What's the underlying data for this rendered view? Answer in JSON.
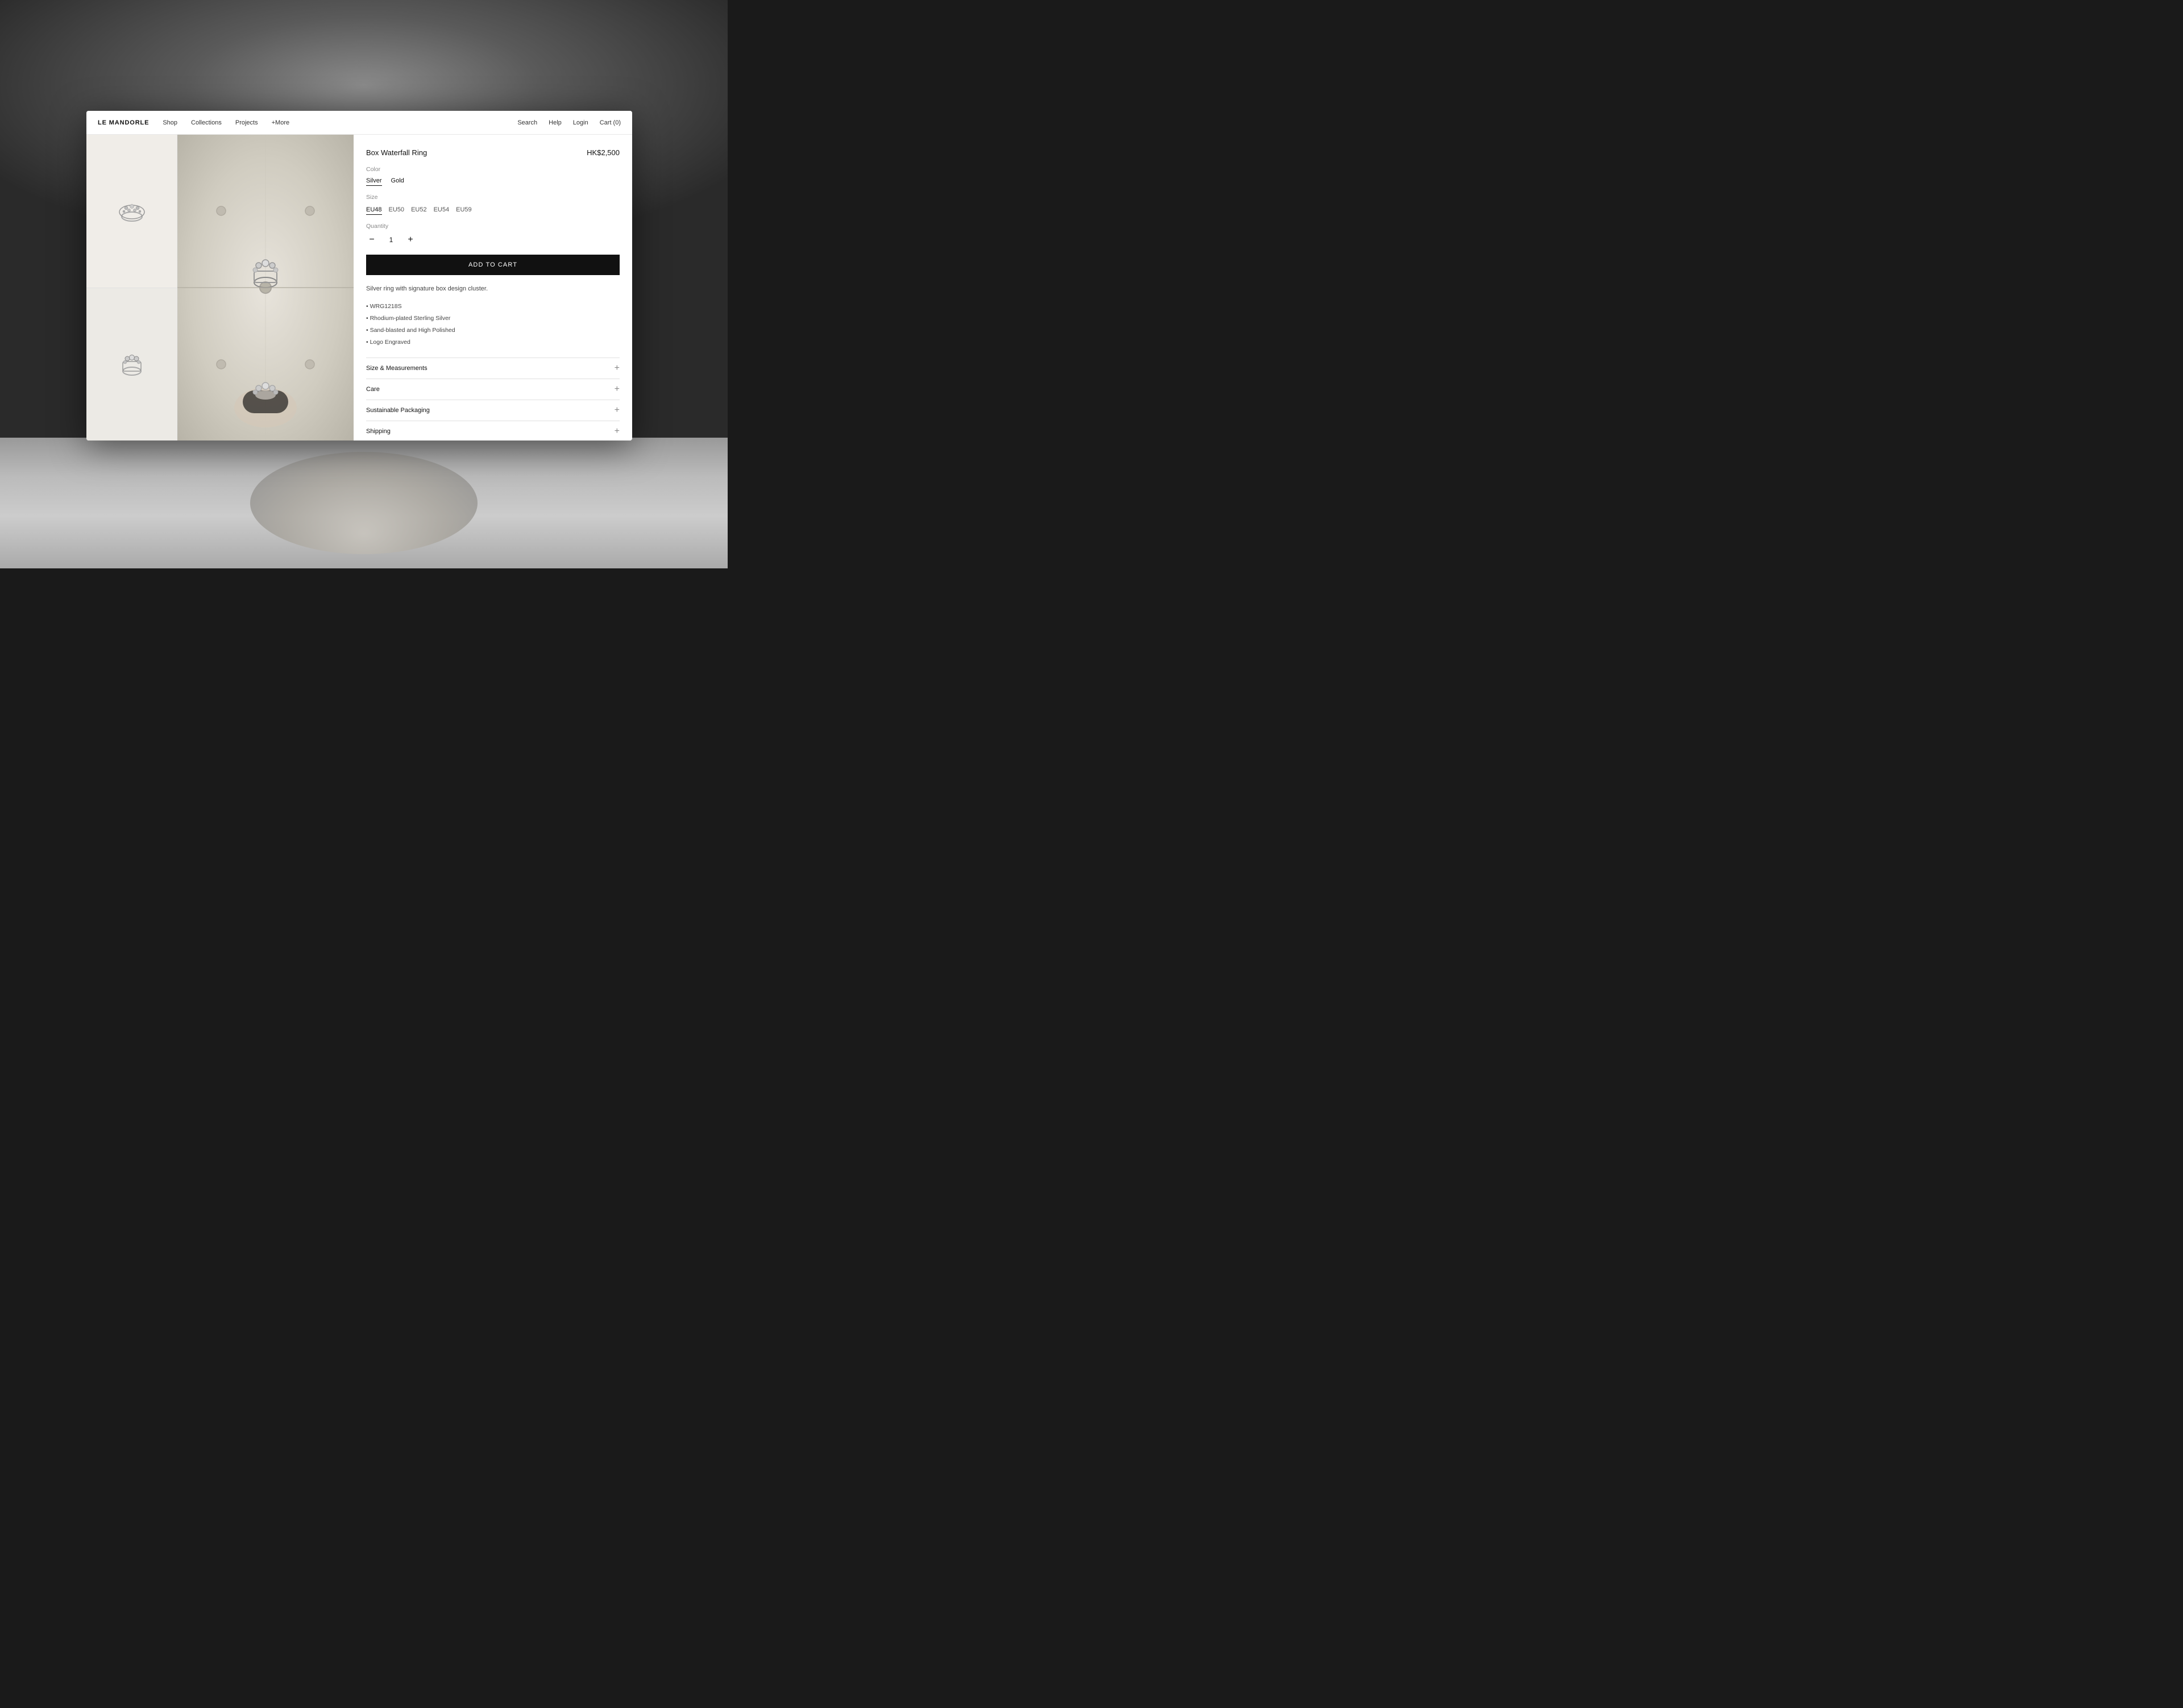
{
  "background": {
    "description": "Black and white photography background showing jewelry/person"
  },
  "navbar": {
    "brand": "LE MANDORLE",
    "links": [
      {
        "label": "Shop",
        "key": "shop"
      },
      {
        "label": "Collections",
        "key": "collections"
      },
      {
        "label": "Projects",
        "key": "projects"
      },
      {
        "label": "+More",
        "key": "more"
      }
    ],
    "right_links": [
      {
        "label": "Search",
        "key": "search"
      },
      {
        "label": "Help",
        "key": "help"
      },
      {
        "label": "Login",
        "key": "login"
      },
      {
        "label": "Cart (0)",
        "key": "cart"
      }
    ]
  },
  "product": {
    "title": "Box Waterfall Ring",
    "price": "HK$2,500",
    "color_label": "Color",
    "colors": [
      "Silver",
      "Gold"
    ],
    "selected_color": "Silver",
    "size_label": "Size",
    "sizes": [
      "EU48",
      "EU50",
      "EU52",
      "EU54",
      "EU59"
    ],
    "selected_size": "EU48",
    "quantity_label": "Quantity",
    "quantity": "1",
    "add_to_cart": "ADD TO CART",
    "description": "Silver ring with signature box design cluster.",
    "specs": [
      "• WRG1218S",
      "• Rhodium-plated Sterling Silver",
      "• Sand-blasted and High Polished",
      "• Logo Engraved"
    ],
    "accordions": [
      {
        "label": "Size & Measurements",
        "key": "size-measurements"
      },
      {
        "label": "Care",
        "key": "care"
      },
      {
        "label": "Sustainable Packaging",
        "key": "sustainable"
      },
      {
        "label": "Shipping",
        "key": "shipping"
      }
    ]
  }
}
